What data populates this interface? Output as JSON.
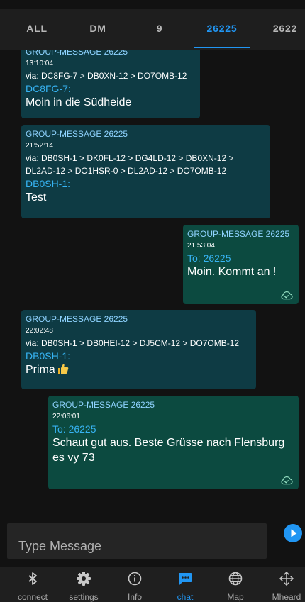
{
  "tabs": [
    {
      "label": "ALL",
      "active": false
    },
    {
      "label": "DM",
      "active": false
    },
    {
      "label": "9",
      "active": false
    },
    {
      "label": "26225",
      "active": true
    },
    {
      "label": "2622",
      "active": false
    }
  ],
  "messages": [
    {
      "direction": "in",
      "header": "GROUP-MESSAGE 26225",
      "time": "13:10:04",
      "via": "via: DC8FG-7 > DB0XN-12 > DO7OMB-12",
      "from": "DC8FG-7:",
      "text": "Moin in die Südheide"
    },
    {
      "direction": "in",
      "header": "GROUP-MESSAGE 26225",
      "time": "21:52:14",
      "via": "via: DB0SH-1 > DK0FL-12 > DG4LD-12 > DB0XN-12 >",
      "via2": "DL2AD-12 > DO1HSR-0 > DL2AD-12 > DO7OMB-12",
      "from": "DB0SH-1:",
      "text": "Test"
    },
    {
      "direction": "out",
      "header": "GROUP-MESSAGE 26225",
      "time": "21:53:04",
      "to": "To: 26225",
      "text": "Moin. Kommt an !",
      "status_icon": "cloud-check-icon"
    },
    {
      "direction": "in",
      "header": "GROUP-MESSAGE 26225",
      "time": "22:02:48",
      "via": "via: DB0SH-1 > DB0HEI-12 > DJ5CM-12 > DO7OMB-12",
      "from": "DB0SH-1:",
      "text": "Prima",
      "emoji": "thumbs-up-icon"
    },
    {
      "direction": "out",
      "header": "GROUP-MESSAGE 26225",
      "time": "22:06:01",
      "to": "To: 26225",
      "text": "Schaut gut aus. Beste Grüsse nach Flensburg",
      "text2": "es vy 73",
      "status_icon": "cloud-check-icon"
    }
  ],
  "composer": {
    "placeholder": "Type Message",
    "send_icon": "send-icon"
  },
  "nav": [
    {
      "label": "connect",
      "icon": "bluetooth-icon",
      "active": false
    },
    {
      "label": "settings",
      "icon": "gear-icon",
      "active": false
    },
    {
      "label": "Info",
      "icon": "info-icon",
      "active": false
    },
    {
      "label": "chat",
      "icon": "chat-icon",
      "active": true
    },
    {
      "label": "Map",
      "icon": "globe-icon",
      "active": false
    },
    {
      "label": "Mheard",
      "icon": "move-icon",
      "active": false
    }
  ],
  "colors": {
    "accent": "#2196f3",
    "incoming_bubble": "#0e3b44",
    "outgoing_bubble": "#0c4a40",
    "background": "#121212"
  }
}
